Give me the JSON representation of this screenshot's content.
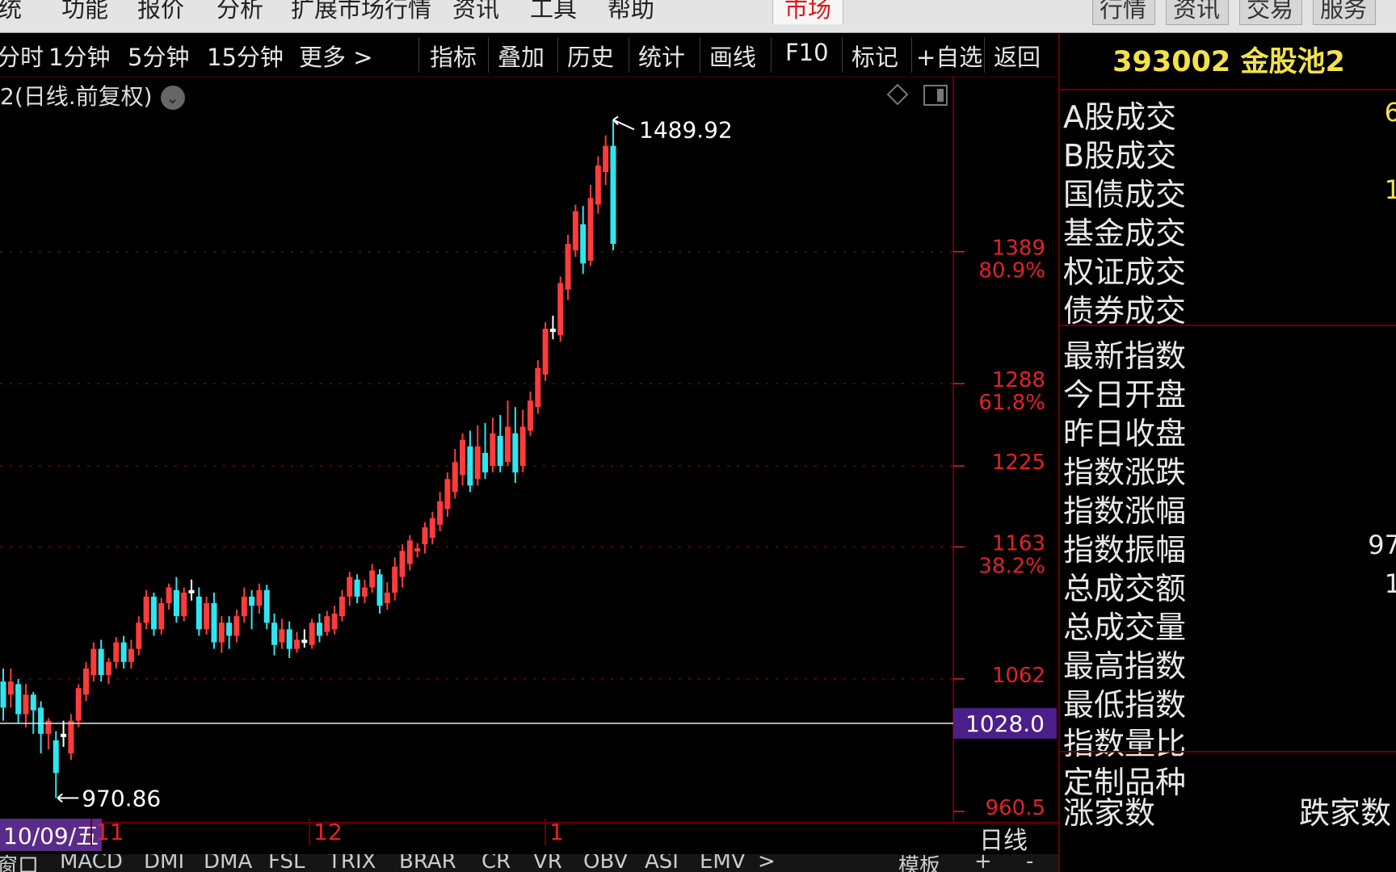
{
  "menu": {
    "items": [
      "统",
      "功能",
      "报价",
      "分析",
      "扩展市场行情",
      "资讯",
      "工具",
      "帮助"
    ],
    "active": "市场",
    "right_tabs": [
      "行情",
      "资讯",
      "交易",
      "服务"
    ]
  },
  "toolbar": {
    "left": [
      "分时",
      "1分钟",
      "5分钟",
      "15分钟",
      "更多 >"
    ],
    "right": [
      "指标",
      "叠加",
      "历史",
      "统计",
      "画线",
      "F10",
      "标记",
      "+自选",
      "返回"
    ]
  },
  "chart": {
    "title": "2(日线.前复权)",
    "high_label": "1489.92",
    "low_label": "970.86",
    "price_marker": "1028.0",
    "date_start": "10/09/五",
    "months": [
      "11",
      "12",
      "1"
    ],
    "period_label": "日线",
    "axis_labels": [
      {
        "value": "1389",
        "pct": "80.9%"
      },
      {
        "value": "1288",
        "pct": "61.8%"
      },
      {
        "value": "1225",
        "pct": ""
      },
      {
        "value": "1163",
        "pct": "38.2%"
      },
      {
        "value": "1062",
        "pct": ""
      },
      {
        "value": "960.5",
        "pct": ""
      }
    ],
    "colors": {
      "up": "#ff3b3b",
      "down": "#2fe6f0",
      "doji": "#ffffff",
      "axis": "#e0222a",
      "grid": "#6b0b0b"
    }
  },
  "chart_data": {
    "type": "candlestick",
    "title": "2(日线.前复权)",
    "ylim": [
      955,
      1505
    ],
    "grid_levels": [
      1389,
      1288,
      1225,
      1163,
      1062
    ],
    "current_price": 1028.0,
    "high": 1489.92,
    "low": 970.86,
    "candles": [
      {
        "o": 1060,
        "c": 1040,
        "h": 1070,
        "l": 1030
      },
      {
        "o": 1050,
        "c": 1060,
        "h": 1070,
        "l": 1040
      },
      {
        "o": 1058,
        "c": 1035,
        "h": 1062,
        "l": 1028
      },
      {
        "o": 1035,
        "c": 1050,
        "h": 1058,
        "l": 1025
      },
      {
        "o": 1050,
        "c": 1038,
        "h": 1052,
        "l": 1020
      },
      {
        "o": 1040,
        "c": 1020,
        "h": 1045,
        "l": 1005
      },
      {
        "o": 1020,
        "c": 1030,
        "h": 1032,
        "l": 1008
      },
      {
        "o": 1015,
        "c": 990,
        "h": 1022,
        "l": 970.86
      },
      {
        "o": 1020,
        "c": 1020,
        "h": 1030,
        "l": 1010
      },
      {
        "o": 1005,
        "c": 1030,
        "h": 1035,
        "l": 1000
      },
      {
        "o": 1030,
        "c": 1055,
        "h": 1058,
        "l": 1025
      },
      {
        "o": 1050,
        "c": 1070,
        "h": 1075,
        "l": 1045
      },
      {
        "o": 1065,
        "c": 1085,
        "h": 1090,
        "l": 1060
      },
      {
        "o": 1085,
        "c": 1065,
        "h": 1092,
        "l": 1060
      },
      {
        "o": 1065,
        "c": 1075,
        "h": 1078,
        "l": 1058
      },
      {
        "o": 1075,
        "c": 1090,
        "h": 1094,
        "l": 1070
      },
      {
        "o": 1090,
        "c": 1075,
        "h": 1095,
        "l": 1070
      },
      {
        "o": 1075,
        "c": 1085,
        "h": 1092,
        "l": 1070
      },
      {
        "o": 1085,
        "c": 1105,
        "h": 1110,
        "l": 1080
      },
      {
        "o": 1105,
        "c": 1125,
        "h": 1130,
        "l": 1100
      },
      {
        "o": 1125,
        "c": 1100,
        "h": 1128,
        "l": 1095
      },
      {
        "o": 1100,
        "c": 1120,
        "h": 1124,
        "l": 1096
      },
      {
        "o": 1120,
        "c": 1132,
        "h": 1135,
        "l": 1115
      },
      {
        "o": 1130,
        "c": 1110,
        "h": 1140,
        "l": 1105
      },
      {
        "o": 1110,
        "c": 1128,
        "h": 1132,
        "l": 1106
      },
      {
        "o": 1130,
        "c": 1130,
        "h": 1138,
        "l": 1122
      },
      {
        "o": 1125,
        "c": 1100,
        "h": 1132,
        "l": 1095
      },
      {
        "o": 1100,
        "c": 1120,
        "h": 1125,
        "l": 1096
      },
      {
        "o": 1120,
        "c": 1090,
        "h": 1128,
        "l": 1085
      },
      {
        "o": 1090,
        "c": 1105,
        "h": 1110,
        "l": 1082
      },
      {
        "o": 1105,
        "c": 1095,
        "h": 1110,
        "l": 1085
      },
      {
        "o": 1095,
        "c": 1110,
        "h": 1115,
        "l": 1090
      },
      {
        "o": 1110,
        "c": 1125,
        "h": 1132,
        "l": 1105
      },
      {
        "o": 1125,
        "c": 1118,
        "h": 1130,
        "l": 1100
      },
      {
        "o": 1118,
        "c": 1130,
        "h": 1135,
        "l": 1112
      },
      {
        "o": 1130,
        "c": 1105,
        "h": 1134,
        "l": 1100
      },
      {
        "o": 1105,
        "c": 1088,
        "h": 1112,
        "l": 1080
      },
      {
        "o": 1090,
        "c": 1100,
        "h": 1108,
        "l": 1085
      },
      {
        "o": 1100,
        "c": 1085,
        "h": 1106,
        "l": 1078
      },
      {
        "o": 1085,
        "c": 1092,
        "h": 1098,
        "l": 1082
      },
      {
        "o": 1092,
        "c": 1092,
        "h": 1100,
        "l": 1086
      },
      {
        "o": 1088,
        "c": 1105,
        "h": 1108,
        "l": 1085
      },
      {
        "o": 1105,
        "c": 1095,
        "h": 1112,
        "l": 1090
      },
      {
        "o": 1098,
        "c": 1110,
        "h": 1114,
        "l": 1095
      },
      {
        "o": 1100,
        "c": 1112,
        "h": 1118,
        "l": 1096
      },
      {
        "o": 1110,
        "c": 1125,
        "h": 1130,
        "l": 1106
      },
      {
        "o": 1125,
        "c": 1140,
        "h": 1144,
        "l": 1118
      },
      {
        "o": 1138,
        "c": 1125,
        "h": 1142,
        "l": 1120
      },
      {
        "o": 1125,
        "c": 1132,
        "h": 1138,
        "l": 1120
      },
      {
        "o": 1132,
        "c": 1145,
        "h": 1150,
        "l": 1128
      },
      {
        "o": 1142,
        "c": 1118,
        "h": 1146,
        "l": 1112
      },
      {
        "o": 1120,
        "c": 1128,
        "h": 1136,
        "l": 1115
      },
      {
        "o": 1128,
        "c": 1148,
        "h": 1155,
        "l": 1122
      },
      {
        "o": 1140,
        "c": 1160,
        "h": 1165,
        "l": 1132
      },
      {
        "o": 1150,
        "c": 1168,
        "h": 1172,
        "l": 1145
      },
      {
        "o": 1160,
        "c": 1162,
        "h": 1166,
        "l": 1155
      },
      {
        "o": 1165,
        "c": 1178,
        "h": 1182,
        "l": 1158
      },
      {
        "o": 1170,
        "c": 1185,
        "h": 1190,
        "l": 1165
      },
      {
        "o": 1180,
        "c": 1198,
        "h": 1205,
        "l": 1175
      },
      {
        "o": 1192,
        "c": 1215,
        "h": 1220,
        "l": 1186
      },
      {
        "o": 1205,
        "c": 1228,
        "h": 1238,
        "l": 1200
      },
      {
        "o": 1218,
        "c": 1245,
        "h": 1250,
        "l": 1210
      },
      {
        "o": 1240,
        "c": 1210,
        "h": 1252,
        "l": 1205
      },
      {
        "o": 1215,
        "c": 1240,
        "h": 1256,
        "l": 1210
      },
      {
        "o": 1235,
        "c": 1220,
        "h": 1258,
        "l": 1215
      },
      {
        "o": 1225,
        "c": 1250,
        "h": 1262,
        "l": 1220
      },
      {
        "o": 1248,
        "c": 1225,
        "h": 1264,
        "l": 1220
      },
      {
        "o": 1228,
        "c": 1255,
        "h": 1275,
        "l": 1225
      },
      {
        "o": 1250,
        "c": 1220,
        "h": 1270,
        "l": 1212
      },
      {
        "o": 1225,
        "c": 1255,
        "h": 1268,
        "l": 1220
      },
      {
        "o": 1252,
        "c": 1275,
        "h": 1282,
        "l": 1248
      },
      {
        "o": 1270,
        "c": 1300,
        "h": 1306,
        "l": 1265
      },
      {
        "o": 1295,
        "c": 1330,
        "h": 1335,
        "l": 1290
      },
      {
        "o": 1330,
        "c": 1330,
        "h": 1340,
        "l": 1322
      },
      {
        "o": 1325,
        "c": 1365,
        "h": 1370,
        "l": 1320
      },
      {
        "o": 1360,
        "c": 1395,
        "h": 1402,
        "l": 1352
      },
      {
        "o": 1390,
        "c": 1420,
        "h": 1425,
        "l": 1385
      },
      {
        "o": 1410,
        "c": 1380,
        "h": 1424,
        "l": 1372
      },
      {
        "o": 1382,
        "c": 1430,
        "h": 1440,
        "l": 1378
      },
      {
        "o": 1425,
        "c": 1455,
        "h": 1462,
        "l": 1418
      },
      {
        "o": 1450,
        "c": 1470,
        "h": 1478,
        "l": 1440
      },
      {
        "o": 1470,
        "c": 1395,
        "h": 1489.92,
        "l": 1390
      }
    ]
  },
  "panel": {
    "title": "393002 金股池2",
    "rows1": [
      {
        "label": "A股成交",
        "value": "6"
      },
      {
        "label": "B股成交",
        "value": ""
      },
      {
        "label": "国债成交",
        "value": "1"
      },
      {
        "label": "基金成交",
        "value": ""
      },
      {
        "label": "权证成交",
        "value": ""
      },
      {
        "label": "债券成交",
        "value": ""
      }
    ],
    "rows2": [
      {
        "label": "最新指数",
        "value": ""
      },
      {
        "label": "今日开盘",
        "value": ""
      },
      {
        "label": "昨日收盘",
        "value": ""
      },
      {
        "label": "指数涨跌",
        "value": ""
      },
      {
        "label": "指数涨幅",
        "value": ""
      },
      {
        "label": "指数振幅",
        "value": "97"
      },
      {
        "label": "总成交额",
        "value": "1"
      },
      {
        "label": "总成交量",
        "value": ""
      },
      {
        "label": "最高指数",
        "value": ""
      },
      {
        "label": "最低指数",
        "value": ""
      },
      {
        "label": "指数量比",
        "value": ""
      },
      {
        "label": "定制品种",
        "value": ""
      }
    ],
    "rise_label": "涨家数",
    "fall_label": "跌家数"
  },
  "bottom_tabs": [
    "窗口",
    "MACD",
    "DMI",
    "DMA",
    "FSL",
    "TRIX",
    "BRAR",
    "CR",
    "VR",
    "OBV",
    "ASI",
    "EMV",
    ">",
    "模板",
    "+",
    "-"
  ]
}
